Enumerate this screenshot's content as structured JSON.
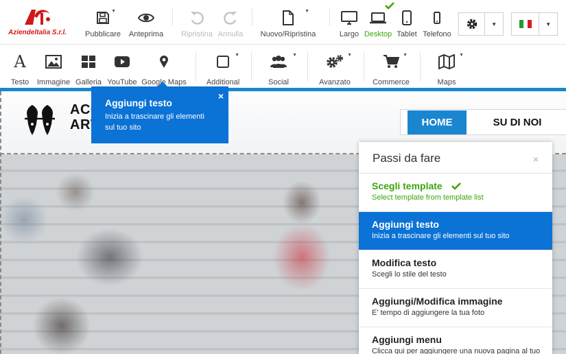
{
  "brand": {
    "name": "Aziendeltalia S.r.l.",
    "accent": "#d01818"
  },
  "toolbar": {
    "publish": "Pubblicare",
    "preview": "Anteprima",
    "restore": "Ripristina",
    "undo": "Annulla",
    "new_restore": "Nuovo/Ripristina",
    "devices": [
      {
        "label": "Largo",
        "icon": "monitor-icon"
      },
      {
        "label": "Desktop",
        "icon": "laptop-icon",
        "active": true
      },
      {
        "label": "Tablet",
        "icon": "tablet-icon"
      },
      {
        "label": "Telefono",
        "icon": "phone-icon"
      }
    ]
  },
  "elements_bar": {
    "items": [
      {
        "label": "Testo",
        "icon": "text-icon"
      },
      {
        "label": "Immagine",
        "icon": "image-icon"
      },
      {
        "label": "Galleria",
        "icon": "gallery-icon"
      },
      {
        "label": "YouTube",
        "icon": "youtube-icon"
      },
      {
        "label": "Google Maps",
        "icon": "map-pin-icon"
      },
      {
        "label": "Additional",
        "icon": "square-icon"
      },
      {
        "label": "Social",
        "icon": "people-icon"
      },
      {
        "label": "Avanzato",
        "icon": "gears-icon"
      },
      {
        "label": "Commerce",
        "icon": "cart-icon"
      },
      {
        "label": "Maps",
        "icon": "map-icon"
      }
    ]
  },
  "site": {
    "name_line1": "ACC",
    "name_line2": "ART",
    "nav": {
      "home": "HOME",
      "about": "SU DI NOI"
    }
  },
  "tooltip": {
    "title": "Aggiungi testo",
    "description": "Inizia a trascinare gli elementi sul tuo sito",
    "close": "×"
  },
  "steps_panel": {
    "title": "Passi da fare",
    "close": "×",
    "steps": [
      {
        "title": "Scegli template",
        "description": "Select template from template list",
        "state": "done"
      },
      {
        "title": "Aggiungi testo",
        "description": "Inizia a trascinare gli elementi sul tuo sito",
        "state": "current"
      },
      {
        "title": "Modifica testo",
        "description": "Scegli lo stile del testo",
        "state": "todo"
      },
      {
        "title": "Aggiungi/Modifica immagine",
        "description": "E' tempo di aggiungere la tua foto",
        "state": "todo"
      },
      {
        "title": "Aggiungi menu",
        "description": "Clicca qui per aggiungere una nuova pagina al tuo",
        "state": "todo"
      }
    ]
  },
  "colors": {
    "primary": "#0b72d6",
    "success": "#3aa60a",
    "accent_line": "#1a86d0"
  }
}
